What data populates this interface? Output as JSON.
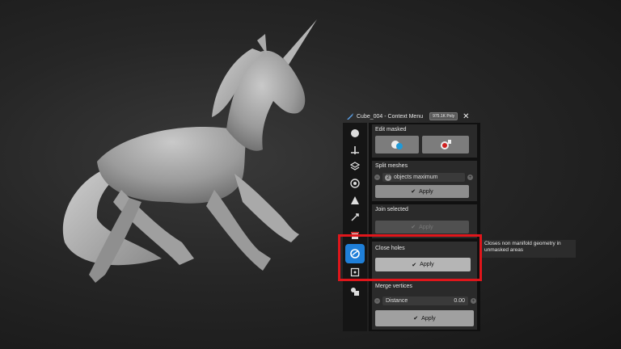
{
  "header": {
    "title": "Cube_004 - Context Menu",
    "poly_badge": "975.1K Poly"
  },
  "sections": {
    "edit_masked": {
      "title": "Edit masked"
    },
    "split_meshes": {
      "title": "Split meshes",
      "count": "2",
      "count_suffix": "objects maximum",
      "apply": "Apply"
    },
    "join_selected": {
      "title": "Join selected",
      "apply": "Apply"
    },
    "close_holes": {
      "title": "Close holes",
      "apply": "Apply"
    },
    "merge_vertices": {
      "title": "Merge vertices",
      "distance_label": "Distance",
      "distance_value": "0.00",
      "apply": "Apply"
    }
  },
  "tooltip": {
    "text": "Closes non manifold geometry in unmasked areas"
  },
  "toolbar_icons": [
    "sculpt-icon",
    "transform-icon",
    "layers-icon",
    "material-icon",
    "scene-icon",
    "tools-icon",
    "context-icon",
    "retopo-icon",
    "boolean-icon"
  ],
  "colors": {
    "accent": "#1f7fd8",
    "highlight": "#e0161b",
    "background": "#262626"
  }
}
